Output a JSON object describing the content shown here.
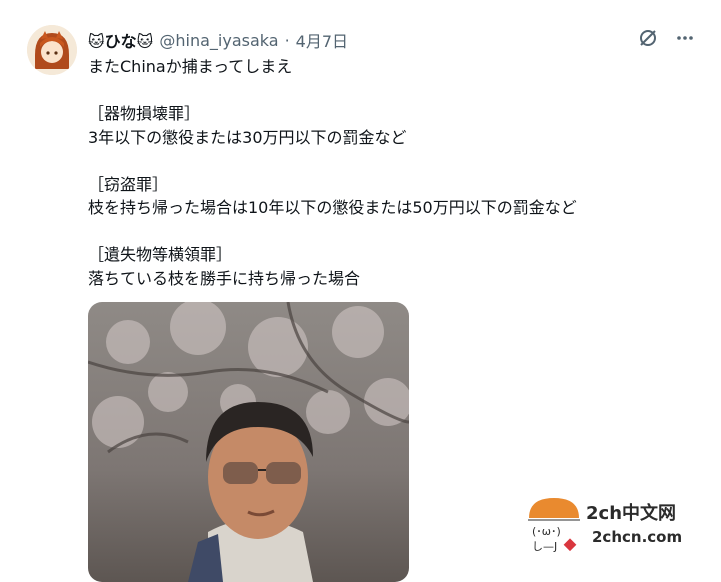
{
  "tweet": {
    "display_name": "🐱ひな🐱",
    "handle": "@hina_iyasaka",
    "sep": "·",
    "date": "4月7日",
    "lines": [
      "またChinaか捕まってしまえ",
      "",
      "［器物損壊罪］",
      "3年以下の懲役または30万円以下の罰金など",
      "",
      "［窃盗罪］",
      "枝を持ち帰った場合は10年以下の懲役または50万円以下の罰金など",
      "",
      "［遺失物等横領罪］",
      "落ちている枝を勝手に持ち帰った場合"
    ]
  },
  "watermark": {
    "title": "2ch中文网",
    "domain": "2chcn.com"
  },
  "icons": [
    "grok-icon",
    "more-icon"
  ],
  "colors": {
    "muted": "#536471",
    "text": "#0f1419"
  }
}
